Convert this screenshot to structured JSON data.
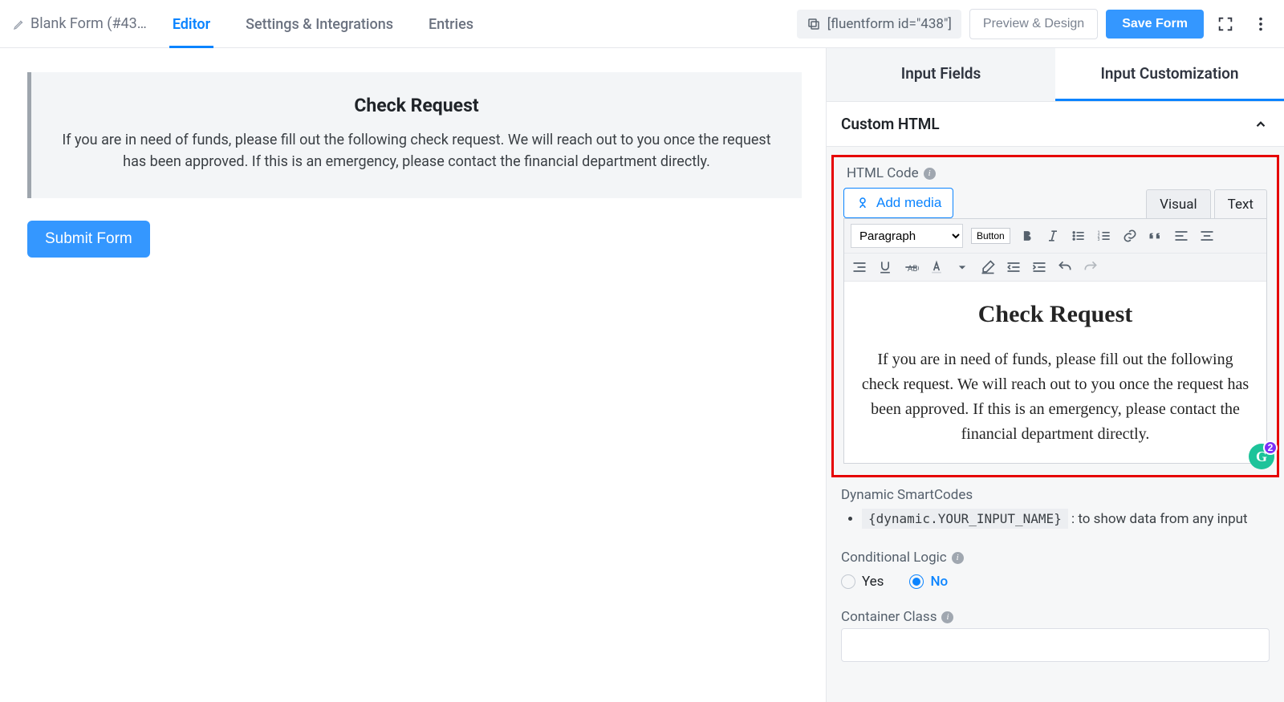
{
  "topbar": {
    "form_title": "Blank Form (#43…",
    "tabs": {
      "editor": "Editor",
      "settings": "Settings & Integrations",
      "entries": "Entries"
    },
    "shortcode": "[fluentform id=\"438\"]",
    "preview_label": "Preview & Design",
    "save_label": "Save Form"
  },
  "canvas": {
    "title": "Check Request",
    "body": "If you are in need of funds, please fill out the following check request. We will reach out to you once the request has been approved. If this is an emergency, please contact the financial department directly.",
    "submit_label": "Submit Form"
  },
  "panel": {
    "side_tabs": {
      "input_fields": "Input Fields",
      "input_customization": "Input Customization"
    },
    "accordion_title": "Custom HTML",
    "html_code_label": "HTML Code",
    "add_media_label": "Add media",
    "mode_tabs": {
      "visual": "Visual",
      "text": "Text"
    },
    "format_select": "Paragraph",
    "button_badge": "Button",
    "editor_title": "Check Request",
    "editor_body": "If you are in need of funds, please fill out the following check request. We will reach out to you once the request has been approved. If this is an emergency, please contact the financial department directly.",
    "grammarly_count": "2",
    "dynamic_label": "Dynamic SmartCodes",
    "dynamic_code": "{dynamic.YOUR_INPUT_NAME}",
    "dynamic_desc": " : to show data from any input",
    "cond_logic_label": "Conditional Logic",
    "cond_yes": "Yes",
    "cond_no": "No",
    "container_class_label": "Container Class"
  }
}
